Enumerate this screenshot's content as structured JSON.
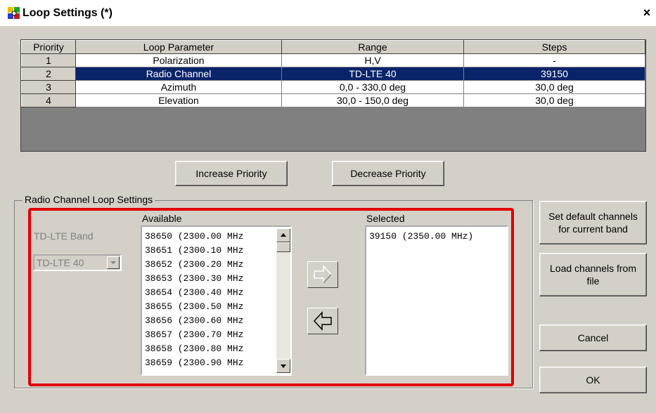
{
  "window": {
    "title": "Loop Settings (*)",
    "close_glyph": "×"
  },
  "grid": {
    "headers": [
      "Priority",
      "Loop Parameter",
      "Range",
      "Steps"
    ],
    "rows": [
      {
        "priority": "1",
        "parameter": "Polarization",
        "range": "H,V",
        "steps": "-"
      },
      {
        "priority": "2",
        "parameter": "Radio Channel",
        "range": "TD-LTE 40",
        "steps": "39150"
      },
      {
        "priority": "3",
        "parameter": "Azimuth",
        "range": "0,0 - 330,0 deg",
        "steps": "30,0 deg"
      },
      {
        "priority": "4",
        "parameter": "Elevation",
        "range": "30,0 - 150,0 deg",
        "steps": "30,0 deg"
      }
    ],
    "selected_row": 2
  },
  "buttons": {
    "increase_priority": "Increase Priority",
    "decrease_priority": "Decrease Priority",
    "set_default": "Set default channels for current band",
    "load_channels": "Load channels from file",
    "cancel": "Cancel",
    "ok": "OK"
  },
  "radio_group": {
    "legend": "Radio Channel Loop Settings",
    "band_label": "TD-LTE Band",
    "band_value": "TD-LTE 40",
    "available_label": "Available",
    "selected_label": "Selected",
    "available_items": [
      "38650  (2300.00 MHz",
      "38651  (2300.10 MHz",
      "38652  (2300.20 MHz",
      "38653  (2300.30 MHz",
      "38654  (2300.40 MHz",
      "38655  (2300.50 MHz",
      "38656  (2300.60 MHz",
      "38657  (2300.70 MHz",
      "38658  (2300.80 MHz",
      "38659  (2300.90 MHz"
    ],
    "selected_items": [
      "39150  (2350.00 MHz)"
    ]
  },
  "icons": {
    "app": "app-icon",
    "close": "close-icon",
    "add": "arrow-right-icon",
    "remove": "arrow-left-icon"
  },
  "colors": {
    "selection": "#0a246a",
    "highlight_border": "#e00000"
  }
}
